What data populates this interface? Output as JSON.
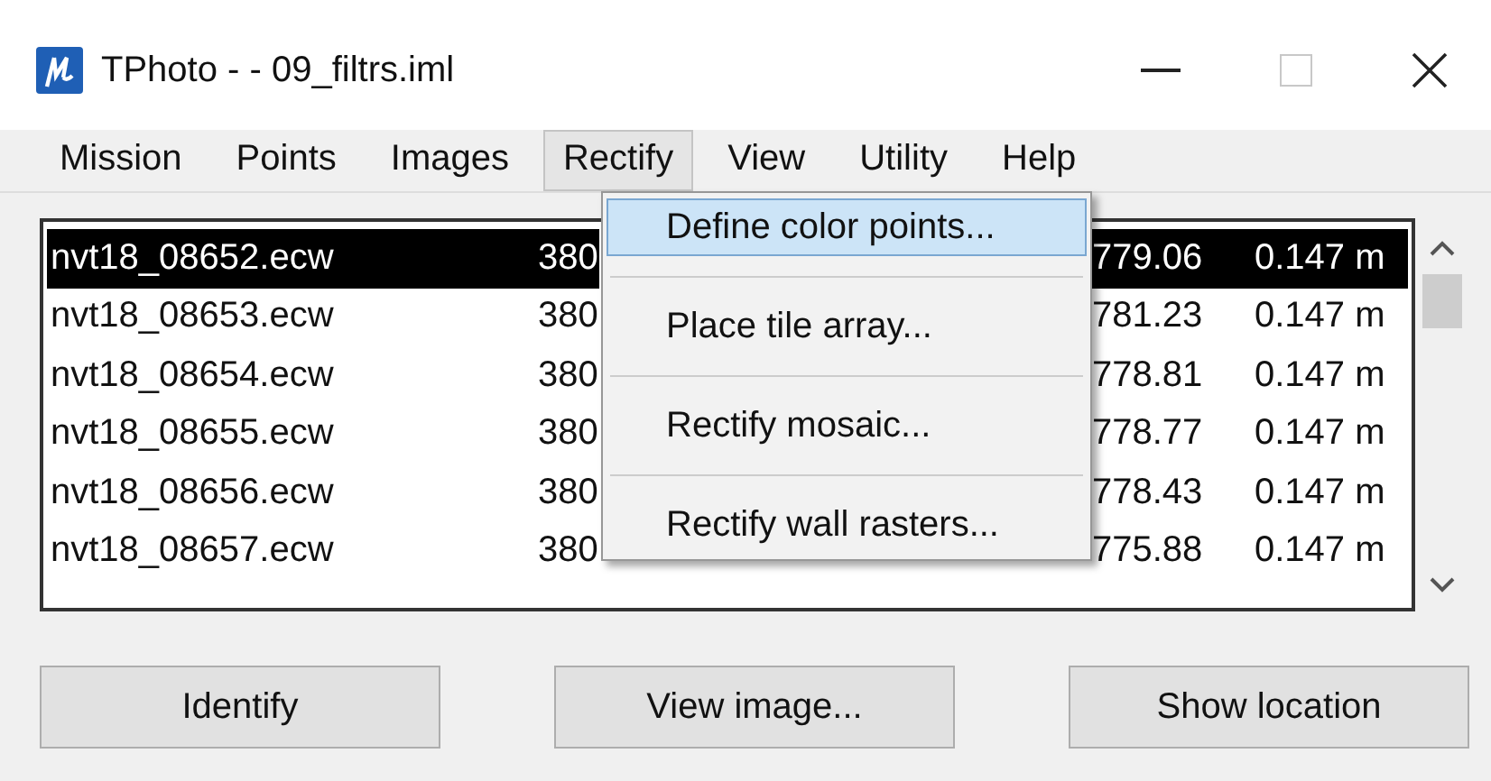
{
  "window": {
    "title": "TPhoto -  - 09_filtrs.iml"
  },
  "menu_bar": [
    {
      "label": "Mission",
      "selected": false
    },
    {
      "label": "Points",
      "selected": false
    },
    {
      "label": "Images",
      "selected": false
    },
    {
      "label": "Rectify",
      "selected": true
    },
    {
      "label": "View",
      "selected": false
    },
    {
      "label": "Utility",
      "selected": false
    },
    {
      "label": "Help",
      "selected": false
    }
  ],
  "dropdown": [
    {
      "label": "Define color points...",
      "selected": true
    },
    {
      "label": "Place tile array...",
      "selected": false
    },
    {
      "label": "Rectify mosaic...",
      "selected": false
    },
    {
      "label": "Rectify wall rasters...",
      "selected": false
    }
  ],
  "list": [
    {
      "name": "nvt18_08652.ecw",
      "column_2": "380",
      "column_3": "779.06",
      "column_4": "0.147 m",
      "selected": true
    },
    {
      "name": "nvt18_08653.ecw",
      "column_2": "380",
      "column_3": "781.23",
      "column_4": "0.147 m",
      "selected": false
    },
    {
      "name": "nvt18_08654.ecw",
      "column_2": "380",
      "column_3": "778.81",
      "column_4": "0.147 m",
      "selected": false
    },
    {
      "name": "nvt18_08655.ecw",
      "column_2": "380",
      "column_3": "778.77",
      "column_4": "0.147 m",
      "selected": false
    },
    {
      "name": "nvt18_08656.ecw",
      "column_2": "380",
      "column_3": "778.43",
      "column_4": "0.147 m",
      "selected": false
    },
    {
      "name": "nvt18_08657.ecw",
      "column_2": "380",
      "column_3": "775.88",
      "column_4": "0.147 m",
      "selected": false
    }
  ],
  "buttons": [
    {
      "label": "Identify"
    },
    {
      "label": "View image..."
    },
    {
      "label": "Show location"
    }
  ]
}
